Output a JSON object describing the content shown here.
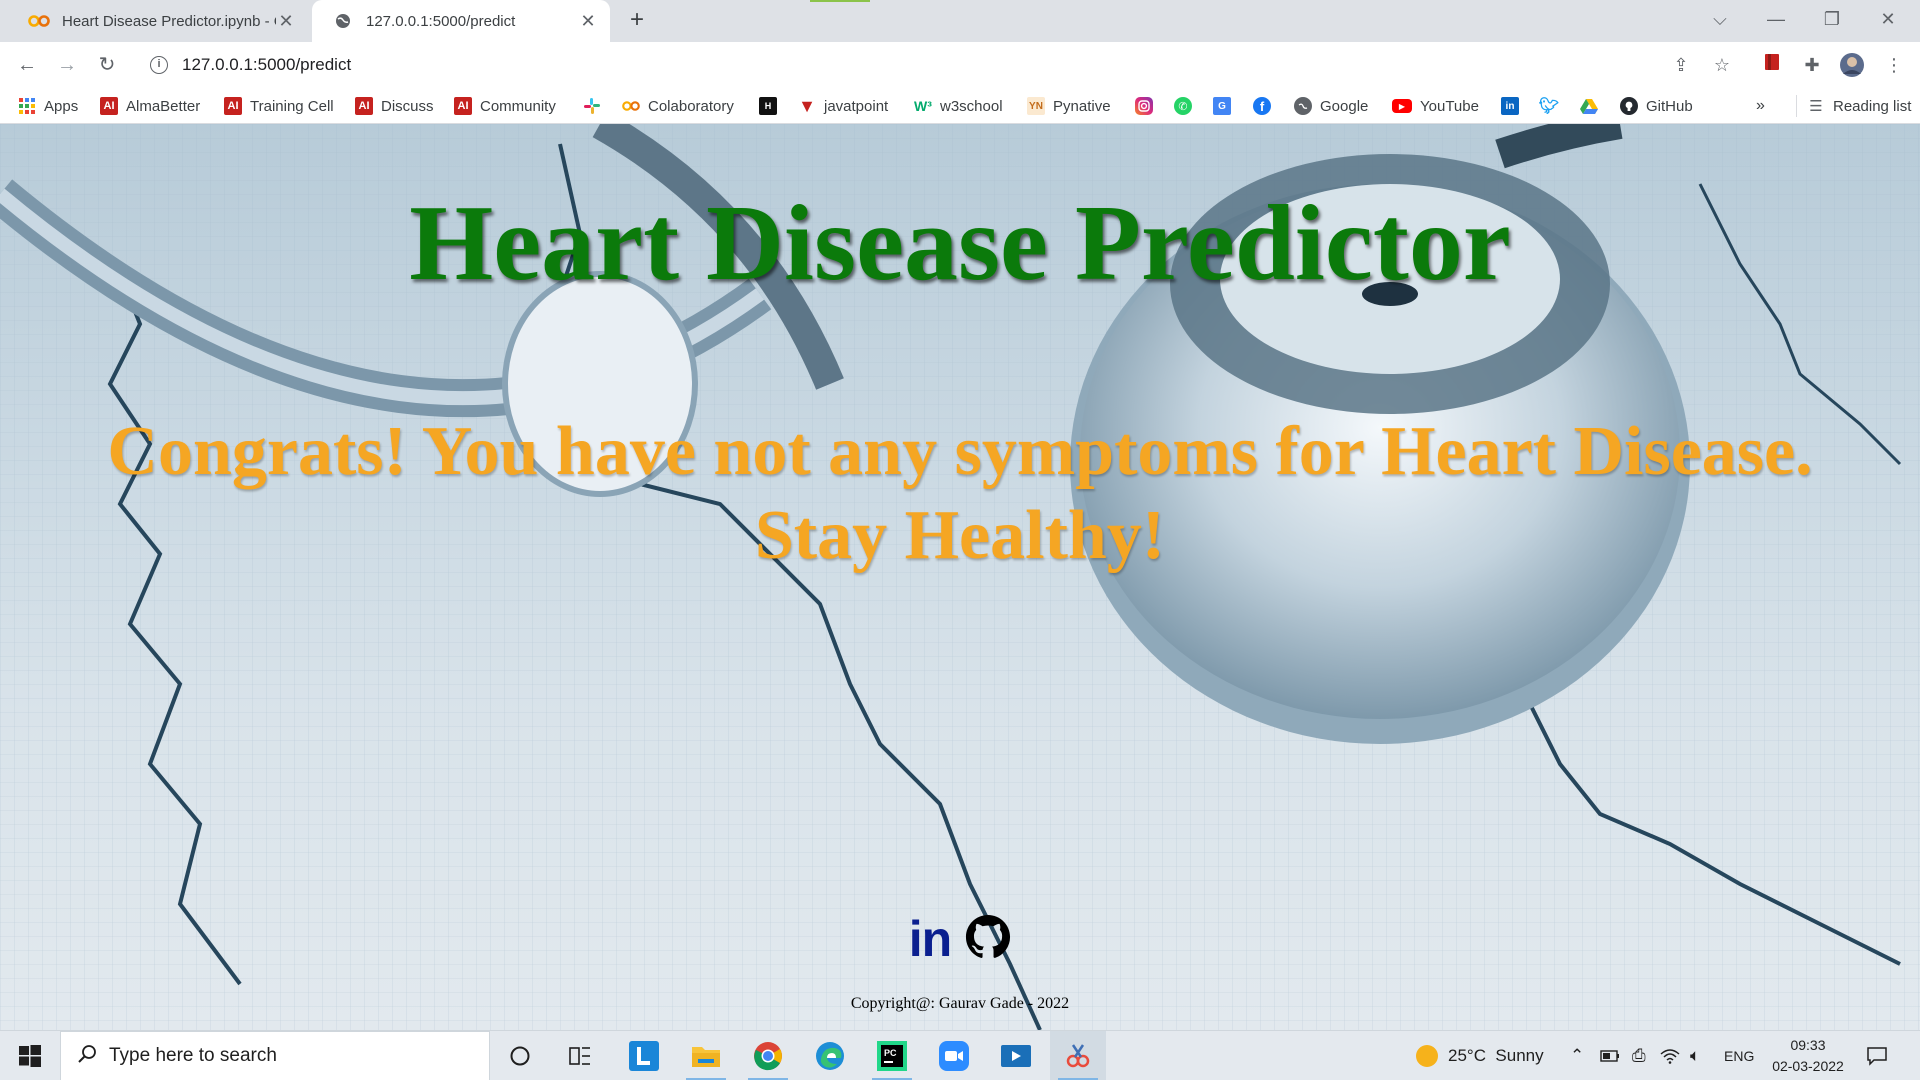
{
  "browser": {
    "tabs": [
      {
        "title": "Heart Disease Predictor.ipynb - Colaboratory",
        "favicon": "colab-icon",
        "active": false
      },
      {
        "title": "127.0.0.1:5000/predict",
        "favicon": "globe-icon",
        "active": true
      }
    ],
    "new_tab": "+",
    "address": "127.0.0.1:5000/predict",
    "bookmarks": [
      {
        "label": "Apps",
        "icon": "apps-grid-icon"
      },
      {
        "label": "AlmaBetter",
        "icon": "almabetter-icon"
      },
      {
        "label": "Training Cell",
        "icon": "almabetter-icon"
      },
      {
        "label": "Discuss",
        "icon": "almabetter-icon"
      },
      {
        "label": "Community",
        "icon": "almabetter-icon"
      },
      {
        "label": "",
        "icon": "slack-icon"
      },
      {
        "label": "Colaboratory",
        "icon": "colab-icon"
      },
      {
        "label": "",
        "icon": "hackerrank-icon"
      },
      {
        "label": "javatpoint",
        "icon": "javatpoint-icon"
      },
      {
        "label": "w3school",
        "icon": "w3schools-icon"
      },
      {
        "label": "Pynative",
        "icon": "pynative-icon"
      },
      {
        "label": "",
        "icon": "instagram-icon"
      },
      {
        "label": "",
        "icon": "whatsapp-icon"
      },
      {
        "label": "",
        "icon": "google-translate-icon"
      },
      {
        "label": "",
        "icon": "facebook-icon"
      },
      {
        "label": "Google",
        "icon": "google-icon"
      },
      {
        "label": "YouTube",
        "icon": "youtube-icon"
      },
      {
        "label": "",
        "icon": "linkedin-icon"
      },
      {
        "label": "",
        "icon": "twitter-icon"
      },
      {
        "label": "",
        "icon": "google-drive-icon"
      },
      {
        "label": "GitHub",
        "icon": "github-icon"
      }
    ],
    "bookmarks_more": "»",
    "reading_list": "Reading list"
  },
  "page": {
    "heading": "Heart Disease Predictor",
    "result_line1": "Congrats! You have not any symptoms for Heart Disease.",
    "result_line2": "Stay Healthy!",
    "linkedin_label": "in",
    "copyright": "Copyright@: Gaurav Gade - 2022",
    "colors": {
      "heading": "#0b7a0b",
      "result": "#f5a623",
      "linkedin": "#0a1f8f"
    }
  },
  "taskbar": {
    "search_placeholder": "Type here to search",
    "weather": "25°C  Sunny",
    "language": "ENG",
    "time": "09:33",
    "date": "02-03-2022"
  }
}
